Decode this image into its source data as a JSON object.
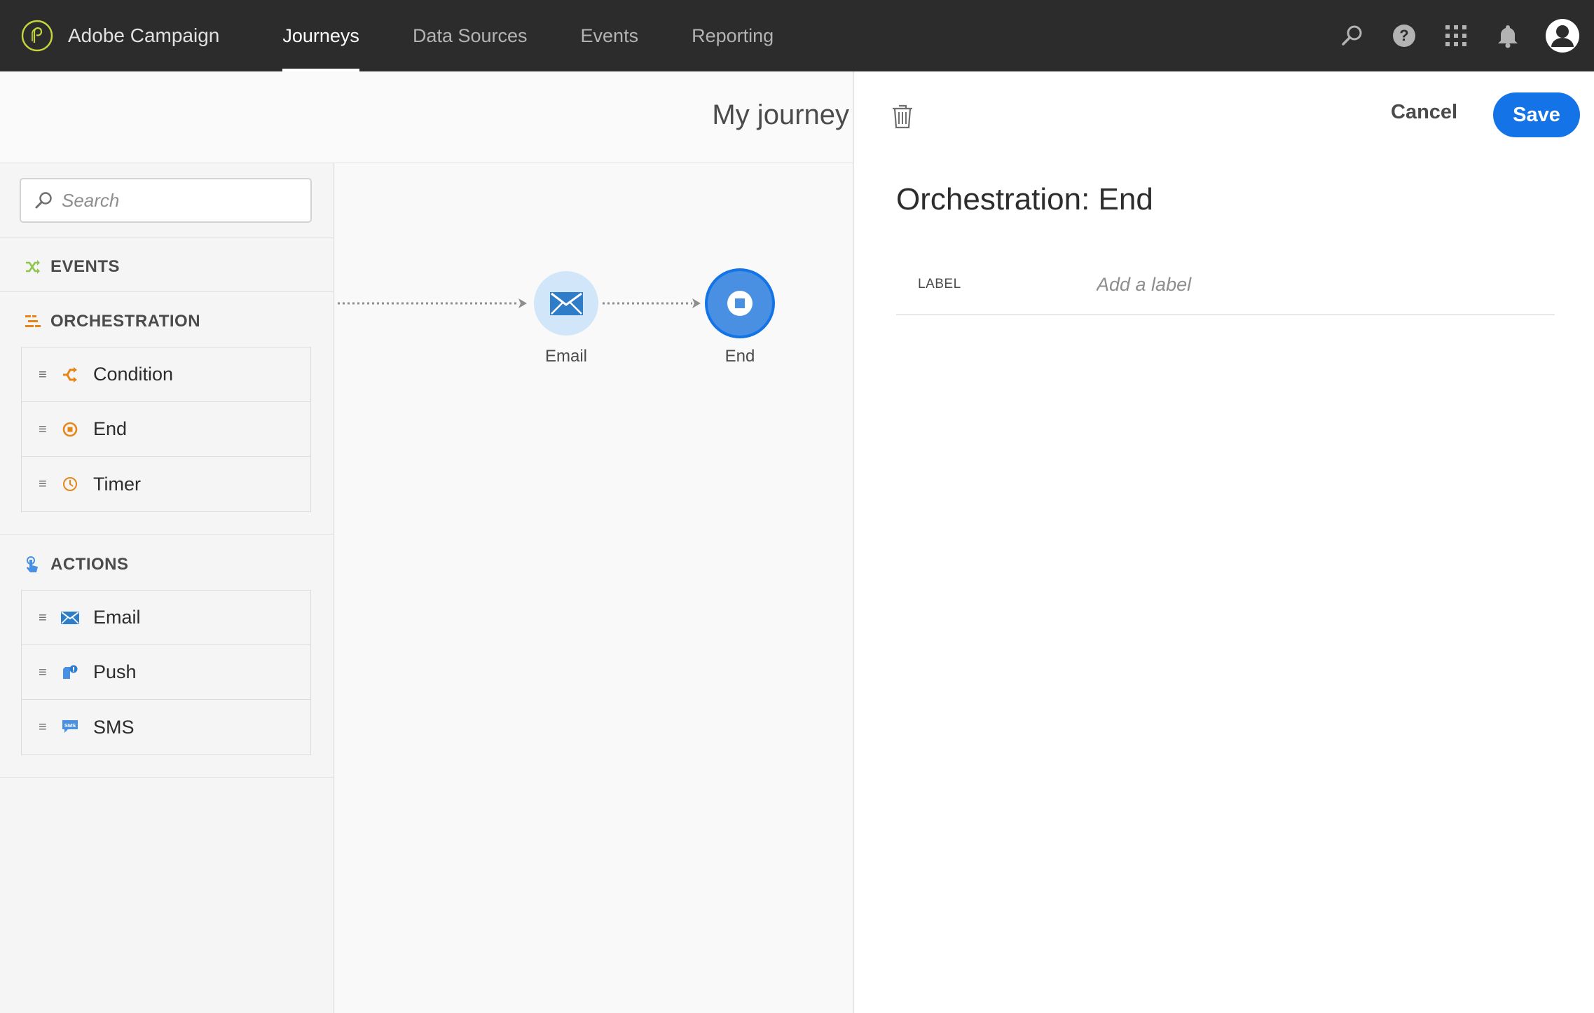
{
  "app": {
    "name": "Adobe Campaign"
  },
  "nav": {
    "tabs": [
      {
        "label": "Journeys",
        "active": true
      },
      {
        "label": "Data Sources",
        "active": false
      },
      {
        "label": "Events",
        "active": false
      },
      {
        "label": "Reporting",
        "active": false
      }
    ],
    "icons": [
      "search-icon",
      "help-icon",
      "apps-grid-icon",
      "notifications-bell-icon",
      "user-avatar-icon"
    ]
  },
  "journey": {
    "title": "My journey"
  },
  "palette": {
    "search": {
      "placeholder": "Search"
    },
    "sections": {
      "events": {
        "title": "EVENTS",
        "icon": "shuffle-icon",
        "color": "#8ec54b"
      },
      "orchestration": {
        "title": "ORCHESTRATION",
        "icon": "orchestration-icon",
        "color": "#e68619",
        "items": [
          {
            "label": "Condition",
            "icon": "condition-icon"
          },
          {
            "label": "End",
            "icon": "end-icon"
          },
          {
            "label": "Timer",
            "icon": "timer-icon"
          }
        ]
      },
      "actions": {
        "title": "ACTIONS",
        "icon": "touch-icon",
        "color": "#4a90e2",
        "items": [
          {
            "label": "Email",
            "icon": "email-icon"
          },
          {
            "label": "Push",
            "icon": "push-icon"
          },
          {
            "label": "SMS",
            "icon": "sms-icon"
          }
        ]
      }
    }
  },
  "canvas": {
    "nodes": [
      {
        "label": "Email",
        "icon": "email-icon",
        "selected": false
      },
      {
        "label": "End",
        "icon": "stop-icon",
        "selected": true
      }
    ]
  },
  "panel": {
    "cancel_label": "Cancel",
    "save_label": "Save",
    "title": "Orchestration: End",
    "label_field": {
      "caption": "LABEL",
      "placeholder": "Add a label",
      "value": ""
    }
  },
  "colors": {
    "accent": "#1473e6",
    "topbar": "#2c2c2c",
    "selected_node": "#4a90e2"
  }
}
